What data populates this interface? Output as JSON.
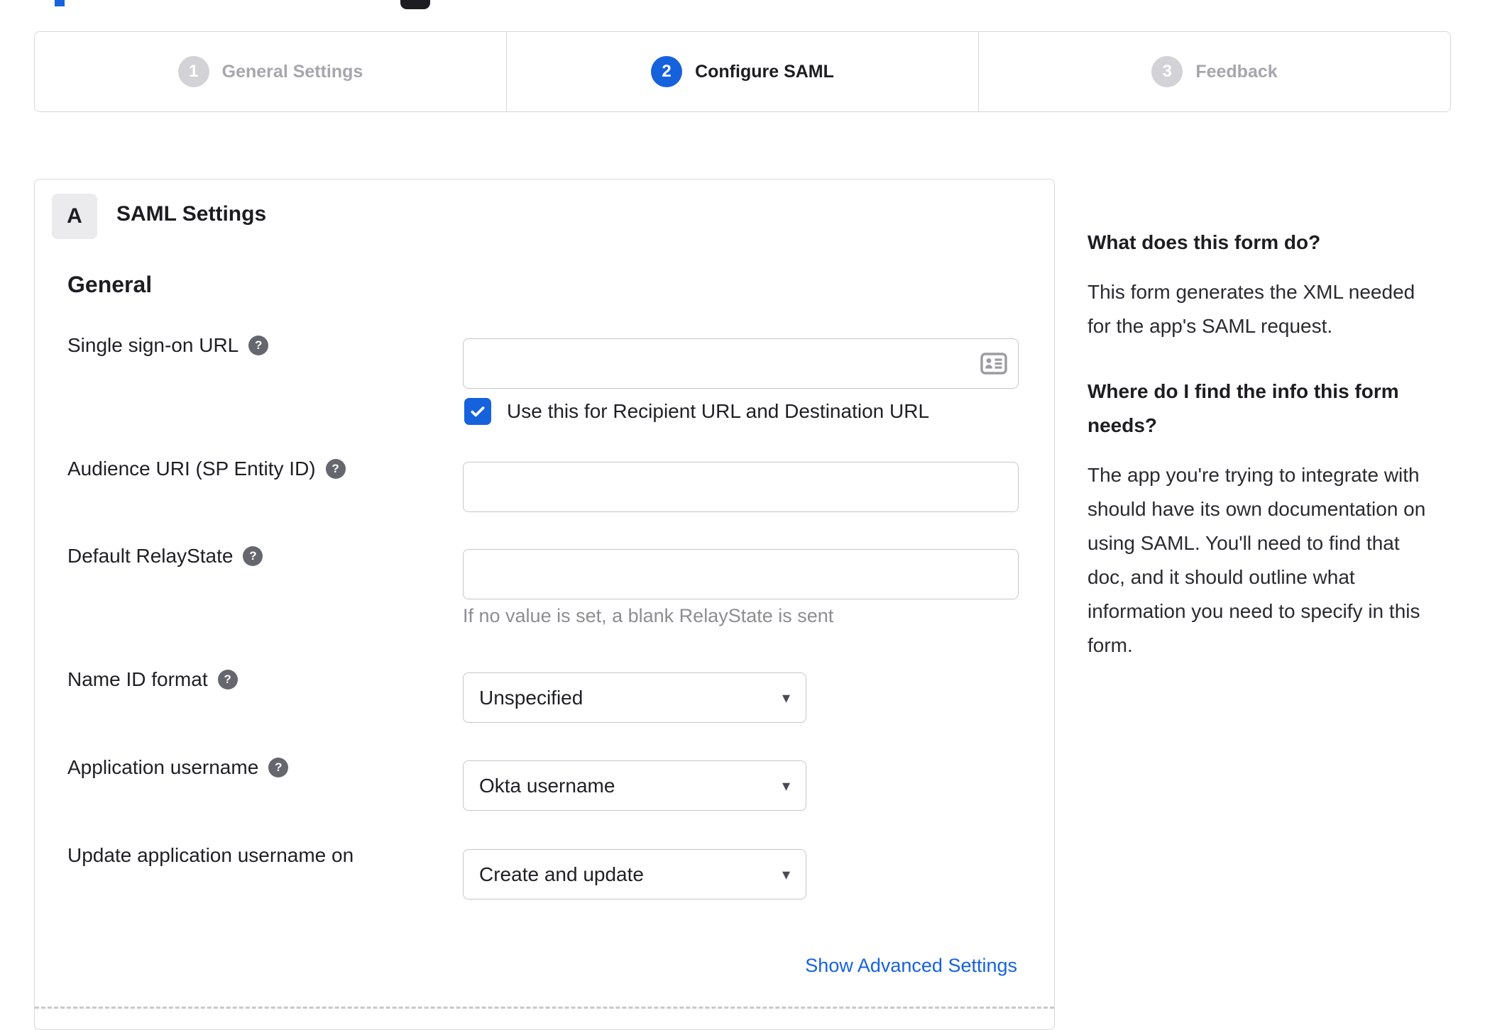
{
  "stepper": {
    "steps": [
      {
        "number": "1",
        "label": "General Settings",
        "state": "inactive"
      },
      {
        "number": "2",
        "label": "Configure SAML",
        "state": "active"
      },
      {
        "number": "3",
        "label": "Feedback",
        "state": "inactive"
      }
    ]
  },
  "panel": {
    "section_badge": "A",
    "section_title": "SAML Settings",
    "group_heading": "General",
    "fields": {
      "sso": {
        "label": "Single sign-on URL",
        "value": "",
        "checkbox_label": "Use this for Recipient URL and Destination URL",
        "checked": true
      },
      "audience": {
        "label": "Audience URI (SP Entity ID)",
        "value": ""
      },
      "relay": {
        "label": "Default RelayState",
        "value": "",
        "hint": "If no value is set, a blank RelayState is sent"
      },
      "nameid": {
        "label": "Name ID format",
        "value": "Unspecified"
      },
      "appuser": {
        "label": "Application username",
        "value": "Okta username"
      },
      "updateuser": {
        "label": "Update application username on",
        "value": "Create and update"
      }
    },
    "advanced_link": "Show Advanced Settings"
  },
  "sidebar": {
    "q1": "What does this form do?",
    "a1": [
      "This form generates the XML needed",
      "for the app's SAML request."
    ],
    "q2": [
      "Where do I find the info this form",
      "needs?"
    ],
    "a2": [
      "The app you're trying to integrate with",
      "should have its own documentation on",
      "using SAML. You'll need to find that",
      "doc, and it should outline what",
      "information you need to specify in this",
      "form."
    ]
  },
  "icons": {
    "help": "?",
    "dropdown_caret": "▾",
    "sso_field_icon": "contact-card"
  },
  "colors": {
    "accent_blue": "#1662dd",
    "text_dark": "#1d1d21",
    "inactive_gray": "#a6a6ac",
    "border_gray": "#d8d8da",
    "hint_gray": "#8d8d93",
    "help_icon_bg": "#66666e"
  }
}
